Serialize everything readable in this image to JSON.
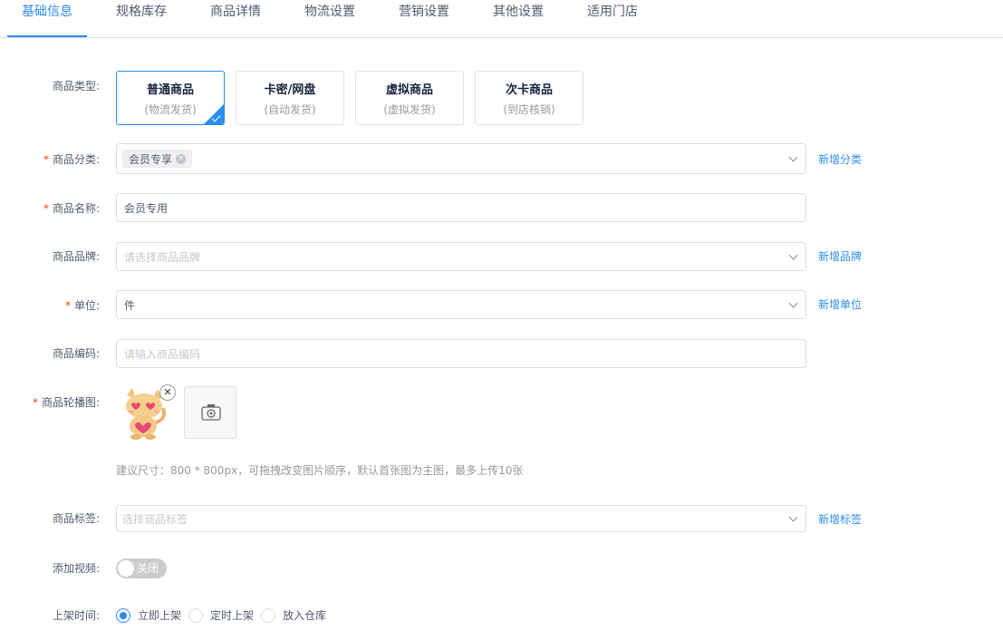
{
  "tabs": [
    {
      "label": "基础信息",
      "active": true
    },
    {
      "label": "规格库存"
    },
    {
      "label": "商品详情"
    },
    {
      "label": "物流设置"
    },
    {
      "label": "营销设置"
    },
    {
      "label": "其他设置"
    },
    {
      "label": "适用门店"
    }
  ],
  "product_type": {
    "label": "商品类型:",
    "options": [
      {
        "title": "普通商品",
        "sub": "(物流发货)",
        "selected": true
      },
      {
        "title": "卡密/网盘",
        "sub": "(自动发货)"
      },
      {
        "title": "虚拟商品",
        "sub": "(虚拟发货)"
      },
      {
        "title": "次卡商品",
        "sub": "(到店核销)"
      }
    ]
  },
  "category": {
    "required_mark": "*",
    "label": "商品分类:",
    "tag": "会员专享",
    "add_link": "新增分类"
  },
  "name": {
    "required_mark": "*",
    "label": "商品名称:",
    "value": "会员专用"
  },
  "brand": {
    "label": "商品品牌:",
    "placeholder": "请选择商品品牌",
    "add_link": "新增品牌"
  },
  "unit": {
    "required_mark": "*",
    "label": "单位:",
    "value": "件",
    "add_link": "新增单位"
  },
  "code": {
    "label": "商品编码:",
    "placeholder": "请输入商品编码"
  },
  "carousel": {
    "required_mark": "*",
    "label": "商品轮播图:",
    "hint": "建议尺寸：800 * 800px，可拖拽改变图片顺序，默认首张图为主图，最多上传10张"
  },
  "tags": {
    "label": "商品标签:",
    "placeholder": "选择商品标签",
    "add_link": "新增标签"
  },
  "video": {
    "label": "添加视频:",
    "switch_text": "关闭"
  },
  "shelf_time": {
    "label": "上架时间:",
    "options": [
      {
        "label": "立即上架",
        "checked": true
      },
      {
        "label": "定时上架"
      },
      {
        "label": "放入仓库"
      }
    ]
  },
  "colors": {
    "primary": "#2d8cf0",
    "required": "#ed4014",
    "border": "#dcdee2"
  }
}
